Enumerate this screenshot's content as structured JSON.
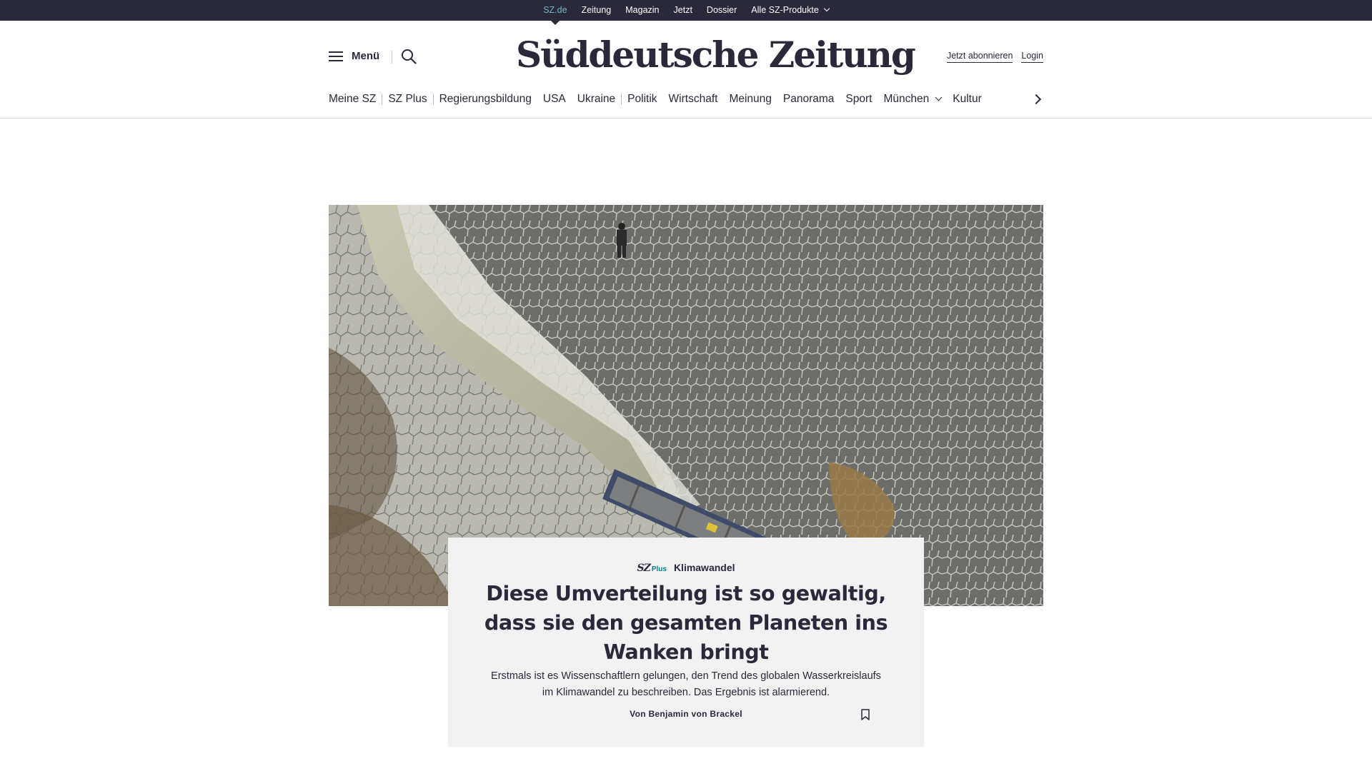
{
  "topbar": {
    "items": [
      {
        "label": "SZ.de",
        "active": true
      },
      {
        "label": "Zeitung",
        "active": false
      },
      {
        "label": "Magazin",
        "active": false
      },
      {
        "label": "Jetzt",
        "active": false
      },
      {
        "label": "Dossier",
        "active": false
      },
      {
        "label": "Alle SZ-Produkte",
        "active": false,
        "dropdown": true
      }
    ]
  },
  "header": {
    "menu_label": "Menü",
    "logo_text": "Süddeutsche Zeitung",
    "subscribe_label": "Jetzt abonnieren",
    "login_label": "Login",
    "search_icon": "search-icon",
    "menu_icon": "hamburger-icon"
  },
  "ressort_nav": {
    "items": [
      {
        "label": "Meine SZ"
      },
      {
        "label": "SZ Plus"
      },
      {
        "label": "Regierungsbildung"
      },
      {
        "label": "USA"
      },
      {
        "label": "Ukraine"
      },
      {
        "label": "Politik"
      },
      {
        "label": "Wirtschaft"
      },
      {
        "label": "Meinung"
      },
      {
        "label": "Panorama"
      },
      {
        "label": "Sport"
      },
      {
        "label": "München"
      },
      {
        "label": "Kultur"
      }
    ],
    "next_icon": "chevron-right-icon"
  },
  "teaser": {
    "badge_sz": "SZ",
    "badge_plus": "Plus",
    "kicker": "Klimawandel",
    "headline": "Diese Umverteilung ist so gewaltig, dass sie den gesamten Planeten ins Wanken bringt",
    "text": "Erstmals ist es Wissenschaftlern gelungen, den Trend des globalen Wasserkreislaufs im Klimawandel zu beschreiben. Das Ergebnis ist alarmierend.",
    "author": "Von Benjamin von Brackel",
    "bookmark_icon": "bookmark-icon"
  },
  "colors": {
    "brand_dark": "#29293a",
    "topbar_active": "#71b7c5",
    "plus_accent": "#00838f",
    "card_bg": "#f2f2f2"
  }
}
